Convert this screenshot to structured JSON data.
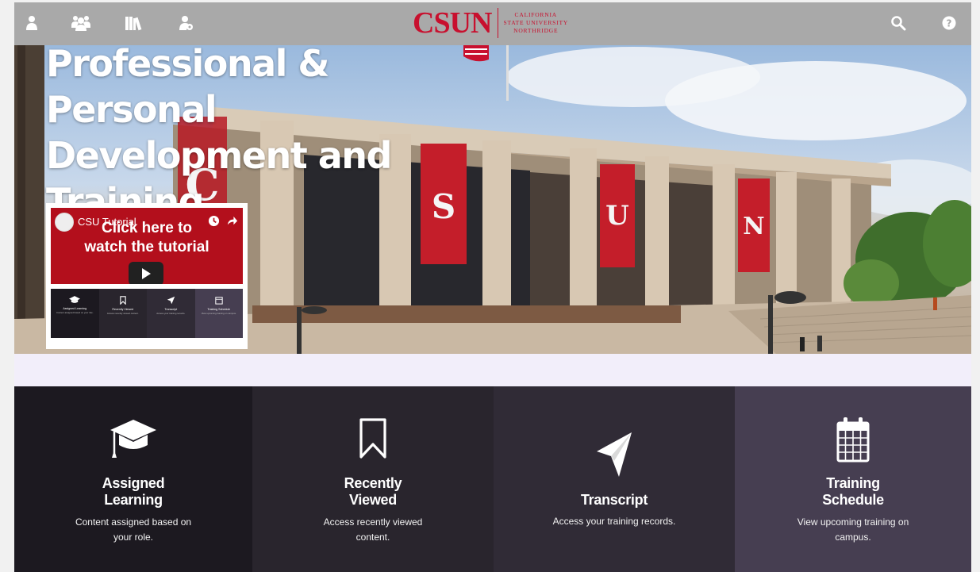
{
  "brand": {
    "wordmark": "CSUN",
    "line1": "California",
    "line2": "State University",
    "line3": "Northridge",
    "color": "#c8102e"
  },
  "topbar": {
    "left_icons": [
      "user-icon",
      "users-icon",
      "library-icon",
      "user-gear-icon"
    ],
    "right_icons": [
      "search-icon",
      "help-icon"
    ],
    "background": "#a9a9a9"
  },
  "hero": {
    "title_line1": "Professional & Personal",
    "title_line2": "Development and",
    "title_line3": "Training",
    "banners": [
      "C",
      "S",
      "U",
      "N"
    ]
  },
  "tutorial": {
    "channel": "CSU Tutorial",
    "headline_line1": "Click here to",
    "headline_line2": "watch the tutorial",
    "mini_tiles": [
      {
        "label": "Assigned Learning",
        "desc": "Content assigned based on your role."
      },
      {
        "label": "Recently Viewed",
        "desc": "Access recently viewed content."
      },
      {
        "label": "Transcript",
        "desc": "Access your training records."
      },
      {
        "label": "Training Schedule",
        "desc": "View upcoming training on campus."
      }
    ]
  },
  "tiles": [
    {
      "title_line1": "Assigned",
      "title_line2": "Learning",
      "desc_line1": "Content assigned based on",
      "desc_line2": "your role.",
      "icon": "graduation-cap-icon",
      "color": "#1c1920"
    },
    {
      "title_line1": "Recently",
      "title_line2": "Viewed",
      "desc_line1": "Access recently viewed",
      "desc_line2": "content.",
      "icon": "bookmark-icon",
      "color": "#29252d"
    },
    {
      "title_line1": "Transcript",
      "title_line2": "",
      "desc_line1": "Access your training records.",
      "desc_line2": "",
      "icon": "paper-plane-icon",
      "color": "#302b36"
    },
    {
      "title_line1": "Training",
      "title_line2": "Schedule",
      "desc_line1": "View upcoming training on",
      "desc_line2": "campus.",
      "icon": "calendar-icon",
      "color": "#463e51"
    }
  ]
}
